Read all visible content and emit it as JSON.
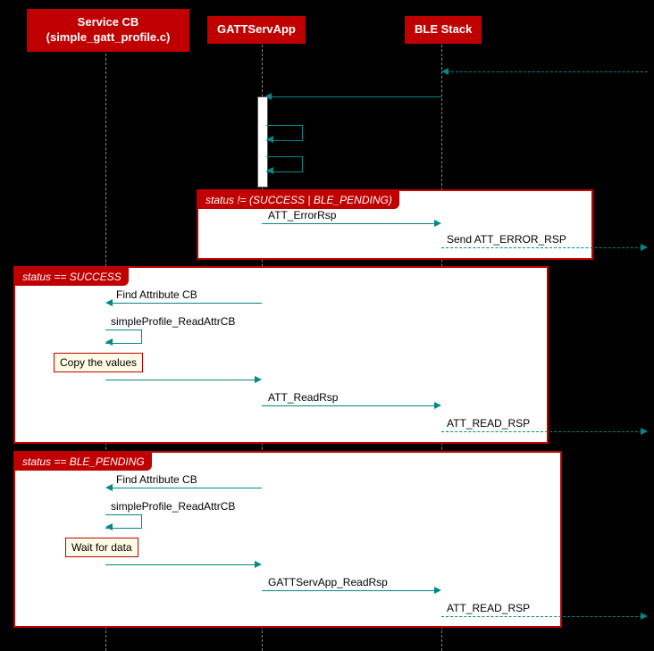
{
  "participants": {
    "serviceCB": {
      "line1": "Service CB",
      "line2": "(simple_gatt_profile.c)"
    },
    "gattServApp": "GATTServApp",
    "bleStack": "BLE Stack"
  },
  "messages": {
    "att_error_rsp": "ATT_ErrorRsp",
    "send_att_error_rsp": "Send ATT_ERROR_RSP",
    "find_attr_cb_1": "Find Attribute CB",
    "read_attr_cb_1": "simpleProfile_ReadAttrCB",
    "att_read_rsp_1": "ATT_ReadRsp",
    "att_read_rsp_out_1": "ATT_READ_RSP",
    "find_attr_cb_2": "Find Attribute CB",
    "read_attr_cb_2": "simpleProfile_ReadAttrCB",
    "gattservapp_read_rsp": "GATTServApp_ReadRsp",
    "att_read_rsp_out_2": "ATT_READ_RSP"
  },
  "alts": {
    "alt1": "status != (SUCCESS | BLE_PENDING)",
    "alt2": "status == SUCCESS",
    "alt3": "status == BLE_PENDING"
  },
  "notes": {
    "copy_values": "Copy the values",
    "wait_for_data": "Wait for data"
  },
  "chart_data": {
    "type": "sequence-diagram",
    "participants": [
      "Service CB (simple_gatt_profile.c)",
      "GATTServApp",
      "BLE Stack"
    ],
    "events": [
      {
        "from": "external",
        "to": "BLE Stack",
        "label": "",
        "style": "dashed"
      },
      {
        "from": "BLE Stack",
        "to": "GATTServApp",
        "label": ""
      },
      {
        "from": "GATTServApp",
        "to": "GATTServApp",
        "label": ""
      },
      {
        "from": "GATTServApp",
        "to": "GATTServApp",
        "label": ""
      },
      {
        "alt": "status != (SUCCESS | BLE_PENDING)",
        "events": [
          {
            "from": "GATTServApp",
            "to": "BLE Stack",
            "label": "ATT_ErrorRsp"
          },
          {
            "from": "BLE Stack",
            "to": "external",
            "label": "Send ATT_ERROR_RSP",
            "style": "dashed"
          }
        ]
      },
      {
        "alt": "status == SUCCESS",
        "events": [
          {
            "from": "GATTServApp",
            "to": "Service CB",
            "label": "Find Attribute CB"
          },
          {
            "from": "Service CB",
            "to": "Service CB",
            "label": "simpleProfile_ReadAttrCB"
          },
          {
            "note": "Copy the values",
            "on": "Service CB"
          },
          {
            "from": "Service CB",
            "to": "GATTServApp",
            "label": ""
          },
          {
            "from": "GATTServApp",
            "to": "BLE Stack",
            "label": "ATT_ReadRsp"
          },
          {
            "from": "BLE Stack",
            "to": "external",
            "label": "ATT_READ_RSP",
            "style": "dashed"
          }
        ]
      },
      {
        "alt": "status == BLE_PENDING",
        "events": [
          {
            "from": "GATTServApp",
            "to": "Service CB",
            "label": "Find Attribute CB"
          },
          {
            "from": "Service CB",
            "to": "Service CB",
            "label": "simpleProfile_ReadAttrCB"
          },
          {
            "note": "Wait for data",
            "on": "Service CB"
          },
          {
            "from": "Service CB",
            "to": "GATTServApp",
            "label": ""
          },
          {
            "from": "GATTServApp",
            "to": "BLE Stack",
            "label": "GATTServApp_ReadRsp"
          },
          {
            "from": "BLE Stack",
            "to": "external",
            "label": "ATT_READ_RSP",
            "style": "dashed"
          }
        ]
      }
    ]
  }
}
